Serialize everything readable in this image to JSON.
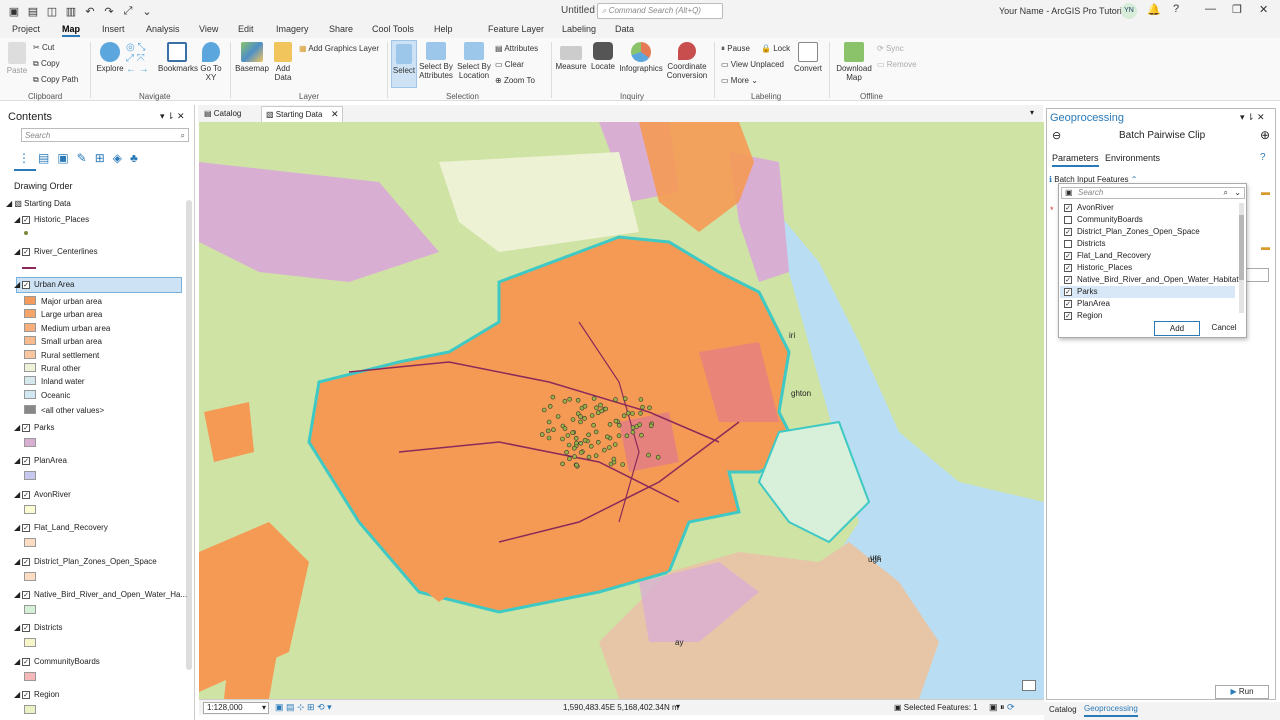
{
  "app": {
    "doc_title": "Untitled",
    "search_placeholder": "Command Search (Alt+Q)",
    "user": "Your Name - ArcGIS Pro Tutorials",
    "initials": "YN"
  },
  "tabs": [
    "Project",
    "Map",
    "Insert",
    "Analysis",
    "View",
    "Edit",
    "Imagery",
    "Share",
    "Cool Tools",
    "Help",
    "Feature Layer",
    "Labeling",
    "Data"
  ],
  "ribbon": {
    "clipboard": {
      "paste": "Paste",
      "cut": "Cut",
      "copy": "Copy",
      "copy_path": "Copy Path",
      "group": "Clipboard"
    },
    "navigate": {
      "explore": "Explore",
      "bookmarks": "Bookmarks",
      "go_to_xy": "Go To XY",
      "group": "Navigate"
    },
    "layer": {
      "basemap": "Basemap",
      "add_data": "Add Data",
      "add_graphics": "Add Graphics Layer",
      "group": "Layer"
    },
    "selection": {
      "select": "Select",
      "select_by_attr": "Select By Attributes",
      "select_by_loc": "Select By Location",
      "attributes": "Attributes",
      "clear": "Clear",
      "zoom_to": "Zoom To",
      "group": "Selection"
    },
    "inquiry": {
      "measure": "Measure",
      "locate": "Locate",
      "infographics": "Infographics",
      "coord": "Coordinate Conversion",
      "group": "Inquiry"
    },
    "labeling": {
      "pause": "Pause",
      "lock": "Lock",
      "view_unplaced": "View Unplaced",
      "more": "More",
      "convert": "Convert",
      "group": "Labeling"
    },
    "offline": {
      "download": "Download Map",
      "sync": "Sync",
      "remove": "Remove",
      "group": "Offline"
    }
  },
  "contents": {
    "title": "Contents",
    "search_placeholder": "Search",
    "drawing_order": "Drawing Order",
    "map_name": "Starting Data",
    "urban_classes": [
      "Major urban area",
      "Large urban area",
      "Medium urban area",
      "Small urban area",
      "Rural settlement",
      "Rural other",
      "Inland water",
      "Oceanic",
      "<all other values>"
    ],
    "urban_colors": [
      "#f29b5b",
      "#f5a56a",
      "#f7b07c",
      "#f8bb8e",
      "#f9c6a0",
      "#edf2d8",
      "#d5e9ec",
      "#d2e8f2",
      "#888888"
    ]
  },
  "layers": {
    "historic": "Historic_Places",
    "river": "River_Centerlines",
    "urban": "Urban Area",
    "parks": "Parks",
    "planarea": "PlanArea",
    "avon": "AvonRiver",
    "flat": "Flat_Land_Recovery",
    "district_plan": "District_Plan_Zones_Open_Space",
    "native": "Native_Bird_River_and_Open_Water_Ha...",
    "districts": "Districts",
    "community": "CommunityBoards",
    "region": "Region"
  },
  "view_tabs": {
    "catalog": "Catalog",
    "starting": "Starting Data"
  },
  "map_labels": {
    "a": "iri",
    "b": "ghton",
    "c": "ugh",
    "d": "urs",
    "e": "ay"
  },
  "status": {
    "scale": "1:128,000",
    "coords": "1,590,483.45E 5,168,402.34N m",
    "selected": "Selected Features: 1"
  },
  "gp": {
    "title": "Geoprocessing",
    "tool": "Batch Pairwise Clip",
    "tab_params": "Parameters",
    "tab_env": "Environments",
    "param_label": "Batch Input Features",
    "search_placeholder": "Search",
    "add": "Add",
    "cancel": "Cancel",
    "run": "Run",
    "items": [
      {
        "name": "AvonRiver",
        "checked": true
      },
      {
        "name": "CommunityBoards",
        "checked": false
      },
      {
        "name": "District_Plan_Zones_Open_Space",
        "checked": true
      },
      {
        "name": "Districts",
        "checked": false
      },
      {
        "name": "Flat_Land_Recovery",
        "checked": true
      },
      {
        "name": "Historic_Places",
        "checked": true
      },
      {
        "name": "Native_Bird_River_and_Open_Water_Habitat",
        "checked": true
      },
      {
        "name": "Parks",
        "checked": true
      },
      {
        "name": "PlanArea",
        "checked": true
      },
      {
        "name": "Region",
        "checked": true
      }
    ]
  },
  "bottom_tabs": {
    "catalog": "Catalog",
    "geoprocessing": "Geoprocessing"
  },
  "colors": {
    "accent": "#2a7ab8",
    "urban": "#f59a55",
    "region": "#cfe3a5",
    "parks": "#d9aed3",
    "water": "#b8dcf0",
    "outline": "#3ec9c4"
  }
}
